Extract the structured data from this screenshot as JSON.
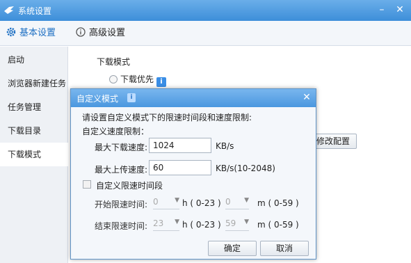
{
  "window": {
    "title": "系统设置"
  },
  "tabs": {
    "basic": "基本设置",
    "advanced": "高级设置"
  },
  "sidebar": {
    "items": [
      {
        "label": "启动"
      },
      {
        "label": "浏览器新建任务"
      },
      {
        "label": "任务管理"
      },
      {
        "label": "下载目录"
      },
      {
        "label": "下载模式"
      }
    ]
  },
  "content": {
    "section_title": "下载模式",
    "radio_label": "下载优先",
    "modify_button": "修改配置"
  },
  "dialog": {
    "title": "自定义模式",
    "description": "请设置自定义模式下的限速时间段和速度限制:",
    "speed_limit_label": "自定义速度限制：",
    "max_download_label": "最大下载速度:",
    "max_download_value": "1024",
    "max_download_unit": "KB/s",
    "max_upload_label": "最大上传速度:",
    "max_upload_value": "60",
    "max_upload_unit": "KB/s(10-2048)",
    "time_period_label": "自定义限速时间段",
    "start_label": "开始限速时间:",
    "start_hour": "0",
    "start_minute": "0",
    "end_label": "结束限速时间:",
    "end_hour": "23",
    "end_minute": "59",
    "hour_range": "h ( 0-23 )",
    "minute_range": "m ( 0-59 )",
    "ok_button": "确定",
    "cancel_button": "取消"
  },
  "colors": {
    "accent": "#3d8ed9",
    "active_tab": "#1d6fc3"
  },
  "icons": {
    "app": "bird-logo-icon",
    "basic": "gear-icon",
    "advanced": "info-circle-icon"
  }
}
